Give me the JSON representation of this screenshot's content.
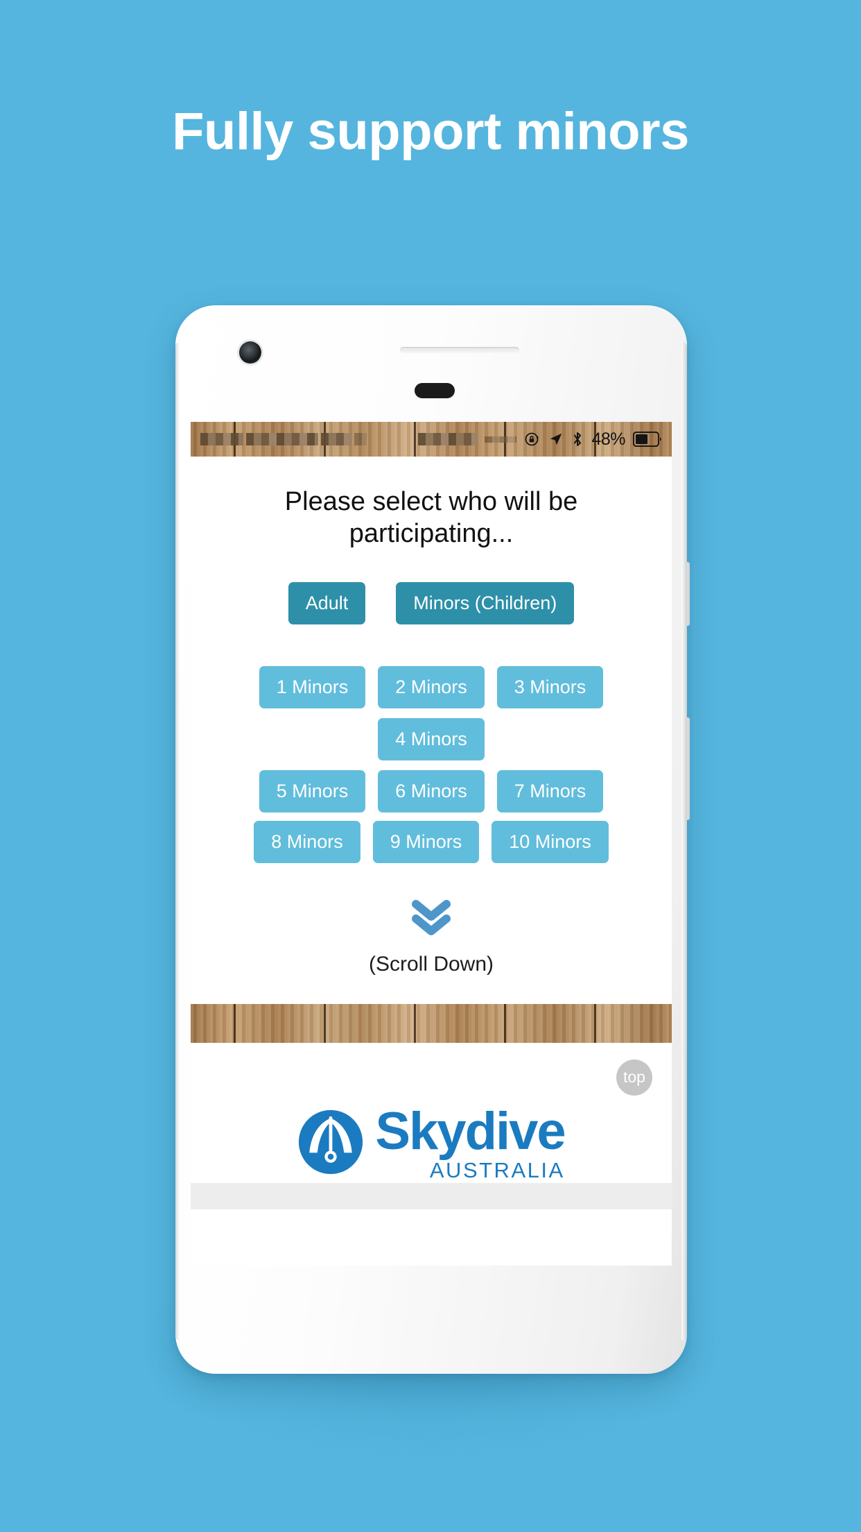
{
  "promo": {
    "headline": "Fully support minors",
    "background_color": "#55b5de",
    "headline_color": "#ffffff"
  },
  "device": {
    "body_color": "#ffffff",
    "hardware": {
      "front_camera": "camera-icon",
      "earpiece": "speaker-grille",
      "sensor": "proximity-sensor",
      "power_button": "power-button",
      "volume_button": "volume-button"
    }
  },
  "status_bar": {
    "left_redacted": "",
    "rotation_lock_icon": "rotation-lock-icon",
    "location_icon": "location-arrow-icon",
    "bluetooth_icon": "bluetooth-icon",
    "battery_percent": "48%",
    "battery_icon": "battery-icon"
  },
  "screen": {
    "prompt": "Please select who will be participating...",
    "participant_type_buttons": [
      {
        "label": "Adult",
        "style": "dark"
      },
      {
        "label": "Minors (Children)",
        "style": "dark"
      }
    ],
    "minor_count_rows": [
      [
        "1 Minors",
        "2 Minors",
        "3 Minors"
      ],
      [
        "4 Minors"
      ],
      [
        "5 Minors",
        "6 Minors",
        "7 Minors"
      ],
      [
        "8 Minors",
        "9 Minors",
        "10 Minors"
      ]
    ],
    "scroll_hint": {
      "icon": "double-chevron-down-icon",
      "label": "(Scroll Down)",
      "icon_color": "#4e96c9"
    },
    "footer": {
      "top_button_label": "top",
      "logo_word": "Skydive",
      "logo_sub": "AUSTRALIA",
      "logo_mark": "skydive-parachute-icon",
      "logo_color": "#1b7bc0"
    }
  },
  "colors": {
    "button_dark": "#2d90a8",
    "button_light": "#61bddc",
    "brand_blue": "#1b7bc0",
    "promo_blue": "#55b5de"
  }
}
